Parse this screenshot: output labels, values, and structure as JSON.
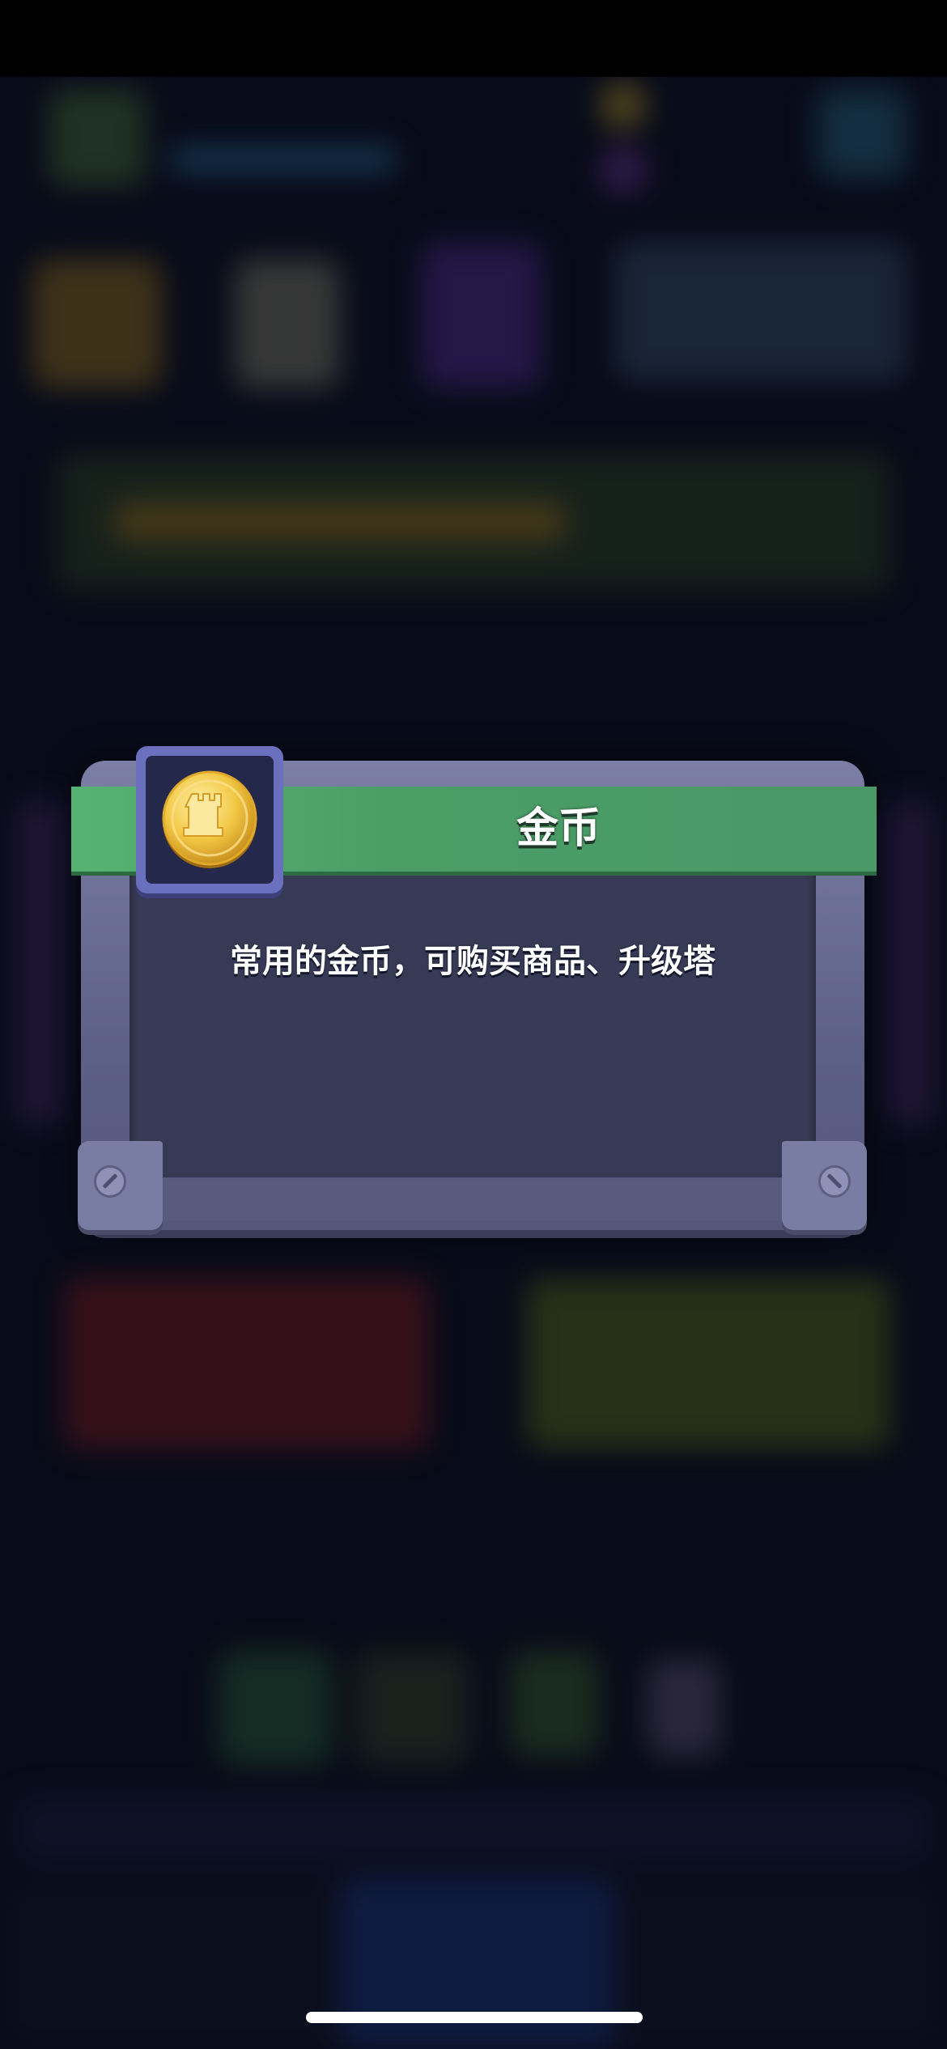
{
  "modal": {
    "title": "金币",
    "description": "常用的金币，可购买商品、升级塔",
    "icon": "gold-coin-tower-icon"
  },
  "colors": {
    "banner_green": "#4a9e66",
    "frame": "#5d6087",
    "panel": "#373a54",
    "icon_frame": "#6a6fbe",
    "coin_gold": "#f2c744"
  }
}
